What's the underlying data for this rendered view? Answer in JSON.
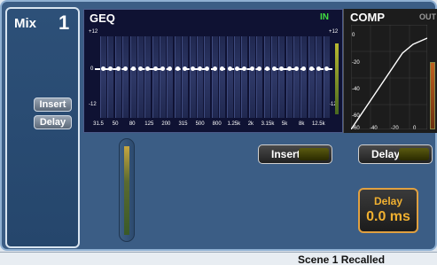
{
  "channel": {
    "label": "Mix",
    "number": "1"
  },
  "left_buttons": {
    "insert": "Insert",
    "delay": "Delay"
  },
  "geq": {
    "title": "GEQ",
    "status": "IN",
    "scale_top_left": "+12",
    "scale_top_right": "+12",
    "scale_mid": "0",
    "scale_bottom_left": "-12",
    "scale_bottom_right": "-12",
    "frequencies": [
      "31.5",
      "50",
      "80",
      "125",
      "200",
      "315",
      "500",
      "800",
      "1.25k",
      "2k",
      "3.15k",
      "5k",
      "8k",
      "12.5k"
    ],
    "band_gains_db": [
      0,
      0,
      0,
      0,
      0,
      0,
      0,
      0,
      0,
      0,
      0,
      0,
      0,
      0,
      0,
      0,
      0,
      0,
      0,
      0,
      0,
      0,
      0,
      0,
      0,
      0,
      0,
      0,
      0,
      0,
      0
    ],
    "colors": {
      "in": "#40e040",
      "line": "#ffffff"
    }
  },
  "comp": {
    "title": "COMP",
    "output_label": "OUT",
    "y_labels": [
      "0",
      "-20",
      "-40",
      "-60"
    ],
    "x_labels": [
      "-60",
      "-40",
      "-20",
      "0"
    ]
  },
  "insert_button": {
    "label": "Insert"
  },
  "delay_button": {
    "label": "Delay"
  },
  "delay_box": {
    "label": "Delay",
    "value": "0.0 ms",
    "accent": "#f0b030"
  },
  "status_bar": {
    "text": "Scene 1 Recalled"
  }
}
